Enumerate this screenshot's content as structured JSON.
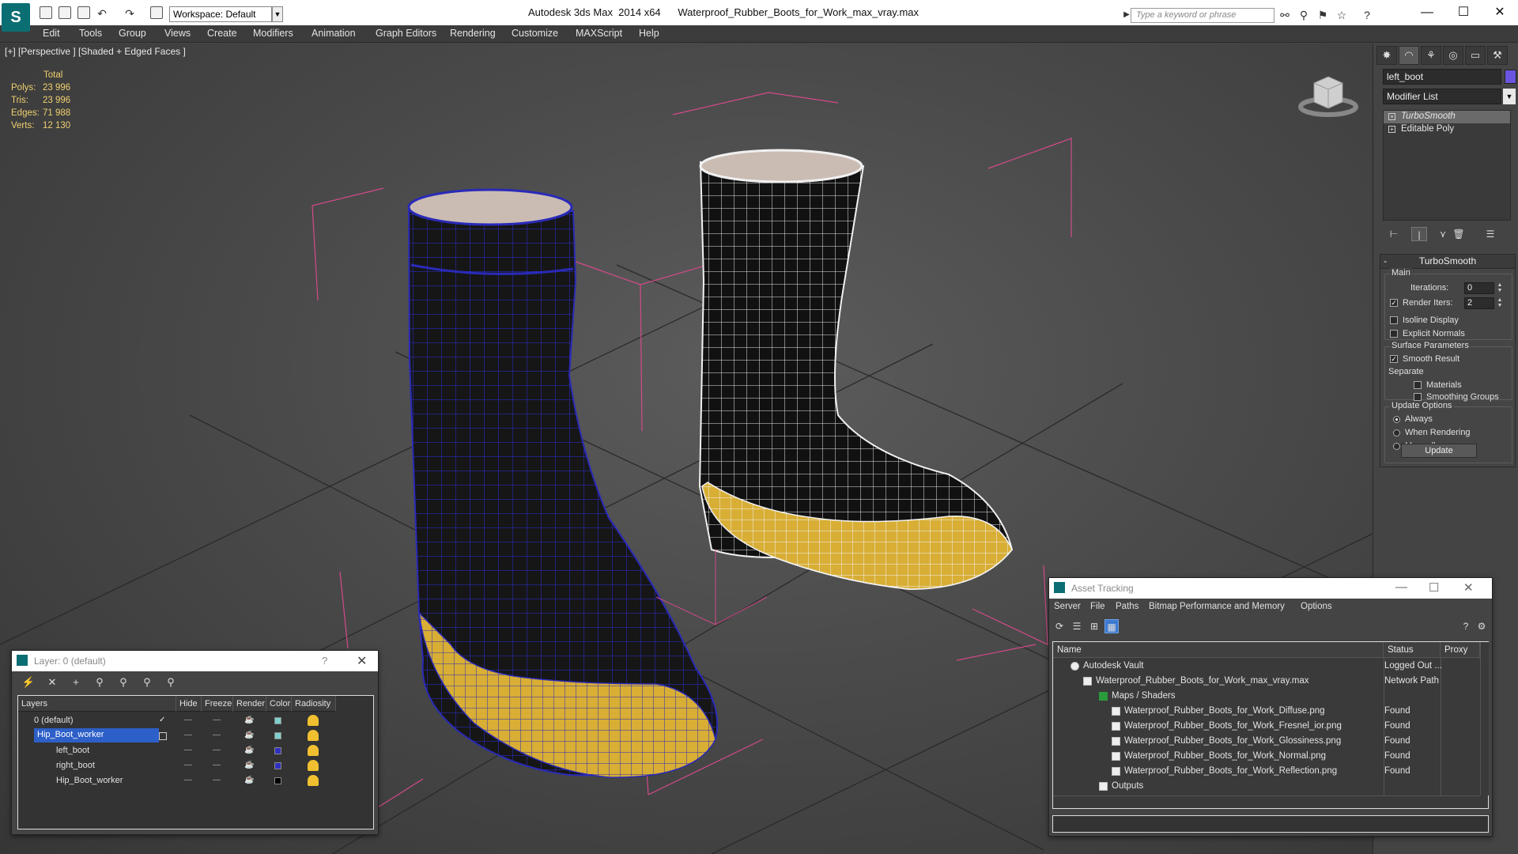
{
  "titlebar": {
    "workspace": "Workspace: Default",
    "title": "Autodesk 3ds Max  2014 x64      Waterproof_Rubber_Boots_for_Work_max_vray.max",
    "search_placeholder": "Type a keyword or phrase"
  },
  "menu": [
    "Edit",
    "Tools",
    "Group",
    "Views",
    "Create",
    "Modifiers",
    "Animation",
    "Graph Editors",
    "Rendering",
    "Customize",
    "MAXScript",
    "Help"
  ],
  "viewport": {
    "label": "[+] [Perspective ] [Shaded + Edged Faces ]",
    "stats": {
      "header": "Total",
      "rows": [
        {
          "label": "Polys:",
          "value": "23 996"
        },
        {
          "label": "Tris:",
          "value": "23 996"
        },
        {
          "label": "Edges:",
          "value": "71 988"
        },
        {
          "label": "Verts:",
          "value": "12 130"
        }
      ]
    }
  },
  "command_panel": {
    "object_name": "left_boot",
    "object_color": "#6a55e0",
    "modifier_list": "Modifier List",
    "stack": [
      "TurboSmooth",
      "Editable Poly"
    ],
    "rollout_title": "TurboSmooth",
    "main_group": "Main",
    "iterations_label": "Iterations:",
    "iterations_value": "0",
    "render_iters_label": "Render Iters:",
    "render_iters_value": "2",
    "isoline": "Isoline Display",
    "explicit_normals": "Explicit Normals",
    "surface_group": "Surface Parameters",
    "smooth_result": "Smooth Result",
    "separate": "Separate",
    "materials": "Materials",
    "smoothing_groups": "Smoothing Groups",
    "update_group": "Update Options",
    "always": "Always",
    "when_rendering": "When Rendering",
    "manually": "Manually",
    "update_button": "Update"
  },
  "layer_dialog": {
    "title": "Layer: 0 (default)",
    "columns": [
      "Layers",
      "Hide",
      "Freeze",
      "Render",
      "Color",
      "Radiosity"
    ],
    "rows": [
      {
        "name": "0 (default)",
        "color": "#7fd0d0"
      },
      {
        "name": "Hip_Boot_worker",
        "color": "#7fd0d0"
      },
      {
        "name": "left_boot",
        "color": "#3030c0"
      },
      {
        "name": "right_boot",
        "color": "#3030c0"
      },
      {
        "name": "Hip_Boot_worker",
        "color": "#000000"
      }
    ]
  },
  "asset_dialog": {
    "title": "Asset Tracking",
    "menu": [
      "Server",
      "File",
      "Paths",
      "Bitmap Performance and Memory",
      "Options"
    ],
    "columns": [
      "Name",
      "Status",
      "Proxy"
    ],
    "rows": [
      {
        "name": "Autodesk Vault",
        "status": "Logged Out ..."
      },
      {
        "name": "Waterproof_Rubber_Boots_for_Work_max_vray.max",
        "status": "Network Path"
      },
      {
        "name": "Maps / Shaders",
        "status": ""
      },
      {
        "name": "Waterproof_Rubber_Boots_for_Work_Diffuse.png",
        "status": "Found"
      },
      {
        "name": "Waterproof_Rubber_Boots_for_Work_Fresnel_ior.png",
        "status": "Found"
      },
      {
        "name": "Waterproof_Rubber_Boots_for_Work_Glossiness.png",
        "status": "Found"
      },
      {
        "name": "Waterproof_Rubber_Boots_for_Work_Normal.png",
        "status": "Found"
      },
      {
        "name": "Waterproof_Rubber_Boots_for_Work_Reflection.png",
        "status": "Found"
      },
      {
        "name": "Outputs",
        "status": ""
      }
    ]
  }
}
